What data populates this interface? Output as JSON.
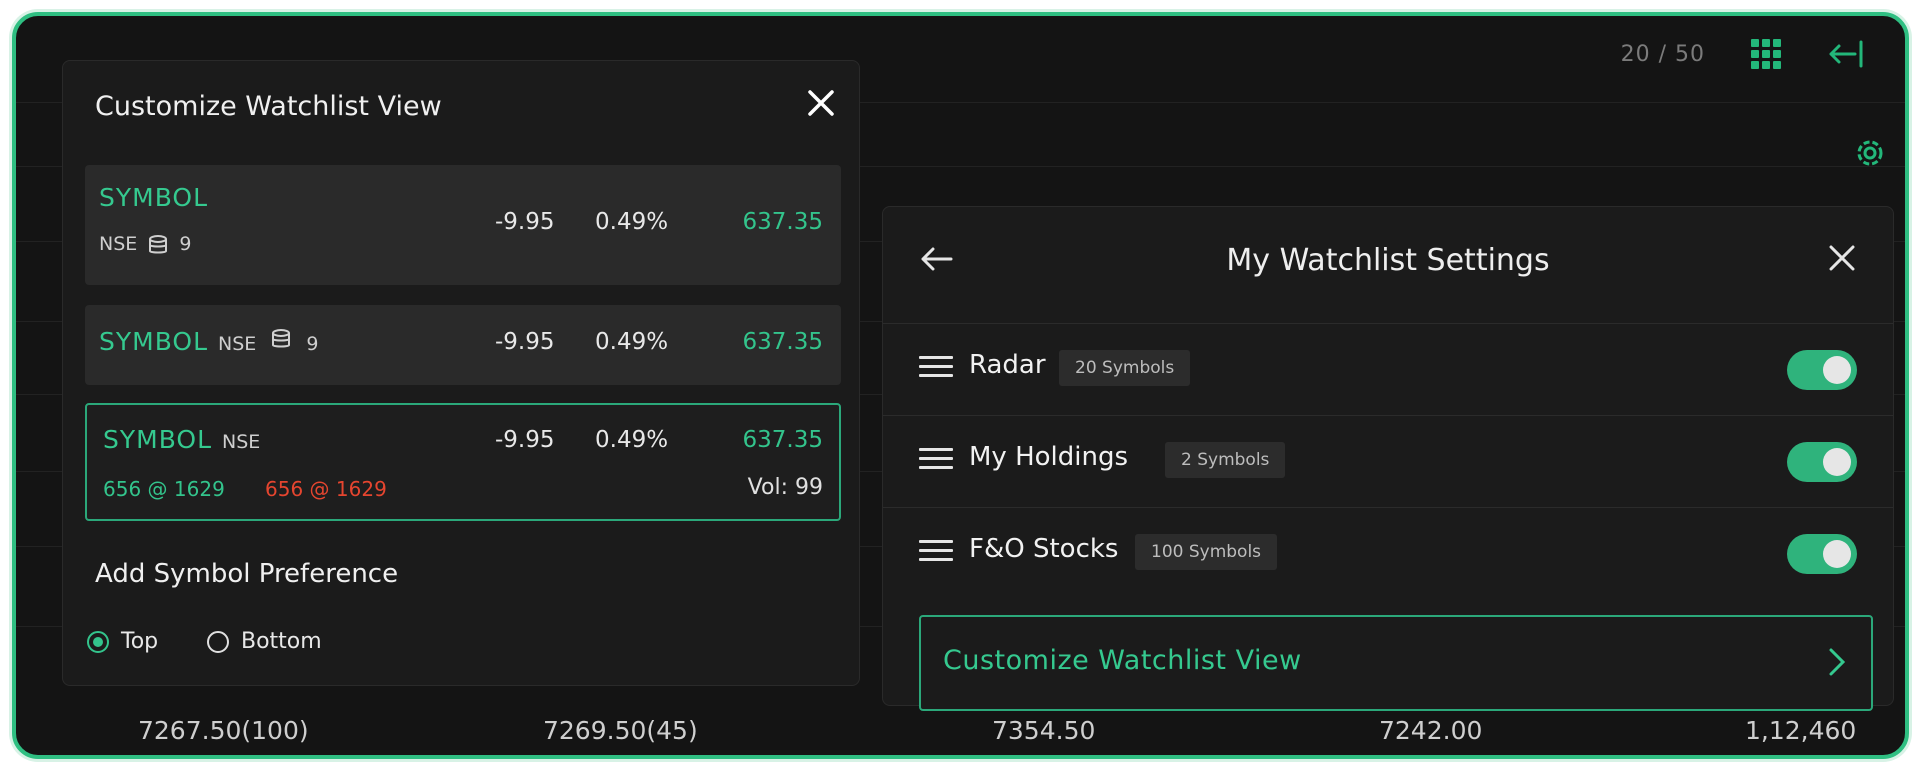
{
  "topbar": {
    "page_count": "20 / 50",
    "grid_icon": "grid-icon",
    "collapse_icon": "collapse-left-icon",
    "settings_icon": "gear-icon"
  },
  "customize_panel": {
    "title": "Customize Watchlist View",
    "cards": [
      {
        "symbol": "SYMBOL",
        "exchange": "NSE",
        "qty": "9",
        "change": "-9.95",
        "pct": "0.49%",
        "ltp": "637.35"
      },
      {
        "symbol": "SYMBOL",
        "exchange": "NSE",
        "qty": "9",
        "change": "-9.95",
        "pct": "0.49%",
        "ltp": "637.35"
      },
      {
        "symbol": "SYMBOL",
        "exchange": "NSE",
        "change": "-9.95",
        "pct": "0.49%",
        "ltp": "637.35",
        "bid": "656 @ 1629",
        "ask": "656 @ 1629",
        "vol": "Vol: 99"
      }
    ],
    "pref_title": "Add Symbol Preference",
    "options": {
      "top": "Top",
      "bottom": "Bottom",
      "selected": "Top"
    }
  },
  "settings_panel": {
    "title": "My Watchlist Settings",
    "watchlists": [
      {
        "name": "Radar",
        "badge": "20 Symbols",
        "enabled": true
      },
      {
        "name": "My Holdings",
        "badge": "2 Symbols",
        "enabled": true
      },
      {
        "name": "F&O Stocks",
        "badge": "100 Symbols",
        "enabled": true
      }
    ],
    "customize_label": "Customize Watchlist View"
  },
  "bottom_values": [
    "7267.50(100)",
    "7269.50(45)",
    "7354.50",
    "7242.00",
    "1,12,460"
  ],
  "colors": {
    "accent": "#2fb37c",
    "positive": "#33c48c",
    "negative": "#e5452f"
  }
}
